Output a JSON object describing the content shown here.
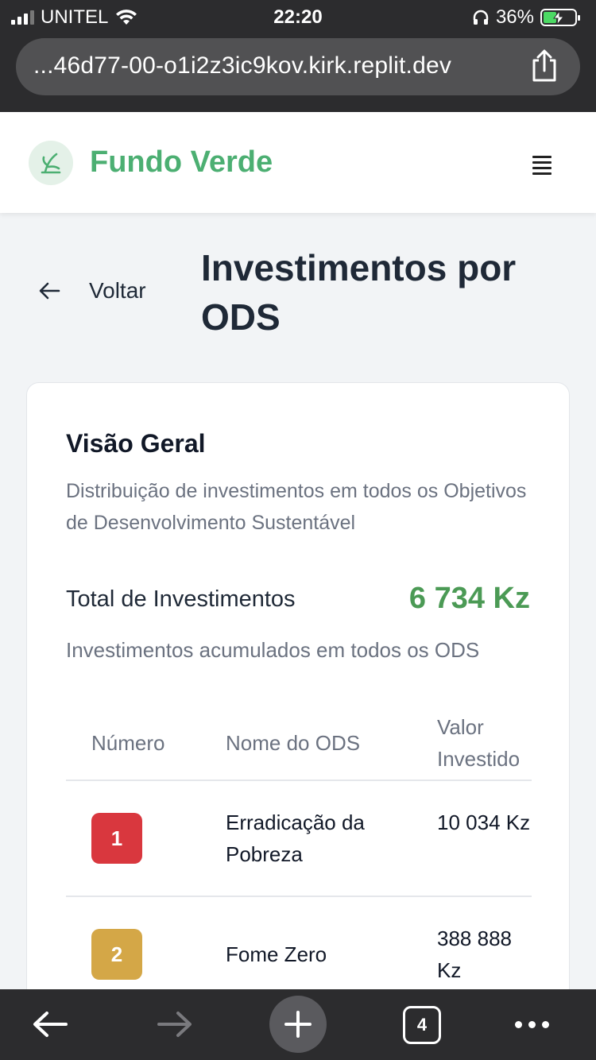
{
  "status_bar": {
    "carrier": "UNITEL",
    "time": "22:20",
    "battery": "36%"
  },
  "browser": {
    "url": "...46d77-00-o1i2z3ic9kov.kirk.replit.dev",
    "tab_count": "4"
  },
  "header": {
    "brand": "Fundo Verde"
  },
  "page": {
    "back_label": "Voltar",
    "title": "Investimentos por ODS"
  },
  "card": {
    "title": "Visão Geral",
    "description": "Distribuição de investimentos em todos os Objetivos de Desenvolvimento Sustentável",
    "total_label": "Total de Investimentos",
    "total_value": "6 734 Kz",
    "total_subtitle": "Investimentos acumulados em todos os ODS"
  },
  "table": {
    "headers": {
      "number": "Número",
      "name": "Nome do ODS",
      "value": "Valor Investido"
    },
    "rows": [
      {
        "number": "1",
        "name": "Erradicação da Pobreza",
        "value": "10 034 Kz",
        "color": "#d9373e"
      },
      {
        "number": "2",
        "name": "Fome Zero",
        "value": "388 888 Kz",
        "color": "#d4a747"
      }
    ]
  },
  "colors": {
    "brand": "#4caf72",
    "total": "#4b9a55",
    "browser_chrome": "#2c2c2e"
  }
}
